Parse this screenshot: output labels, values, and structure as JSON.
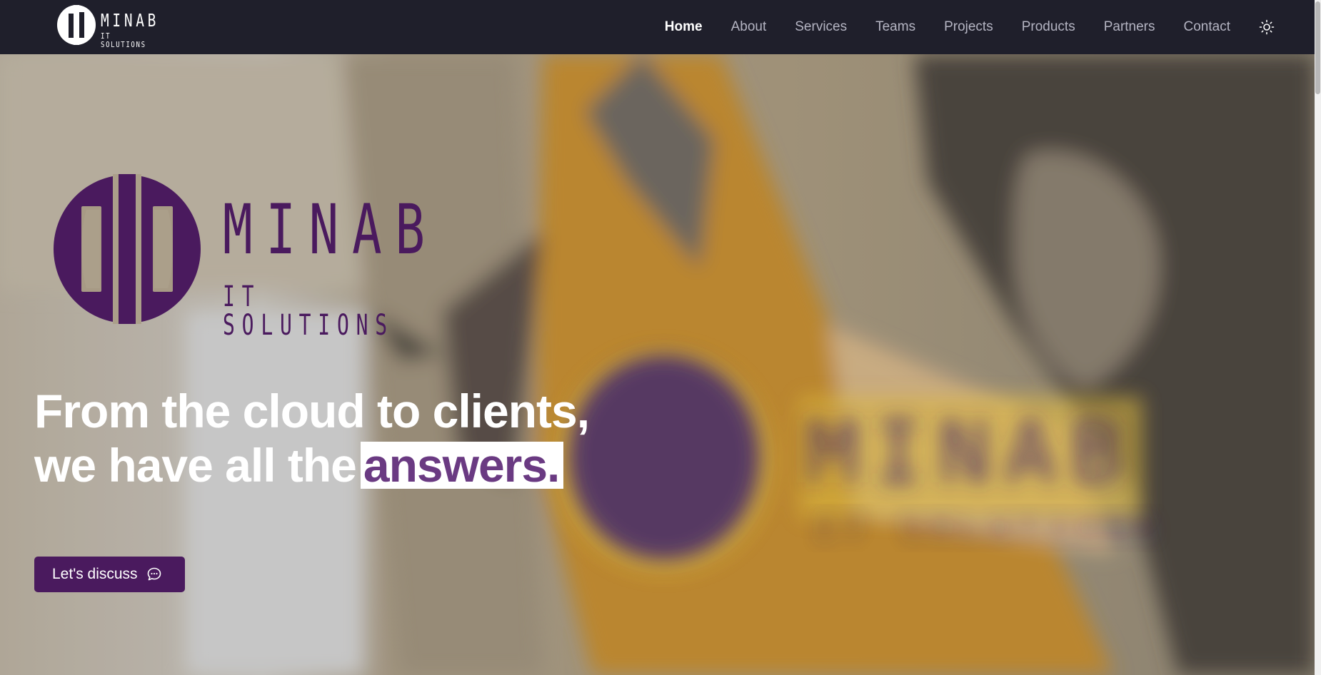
{
  "brand": {
    "name": "MINAB",
    "tagline": "IT SOLUTIONS"
  },
  "nav": {
    "items": [
      {
        "label": "Home",
        "active": true
      },
      {
        "label": "About",
        "active": false
      },
      {
        "label": "Services",
        "active": false
      },
      {
        "label": "Teams",
        "active": false
      },
      {
        "label": "Projects",
        "active": false
      },
      {
        "label": "Products",
        "active": false
      },
      {
        "label": "Partners",
        "active": false
      },
      {
        "label": "Contact",
        "active": false
      }
    ],
    "theme_toggle_icon": "sun-icon"
  },
  "hero": {
    "headline_line1": "From the cloud to clients,",
    "headline_line2": "we have all the",
    "headline_highlight": "answers.",
    "cta_label": "Let's discuss",
    "cta_icon": "chat-bubble-icon"
  },
  "colors": {
    "nav_bg": "#1f1f2b",
    "brand_purple": "#4a1a5e",
    "highlight_text": "#6a3a82",
    "mustard": "#c9962f"
  }
}
